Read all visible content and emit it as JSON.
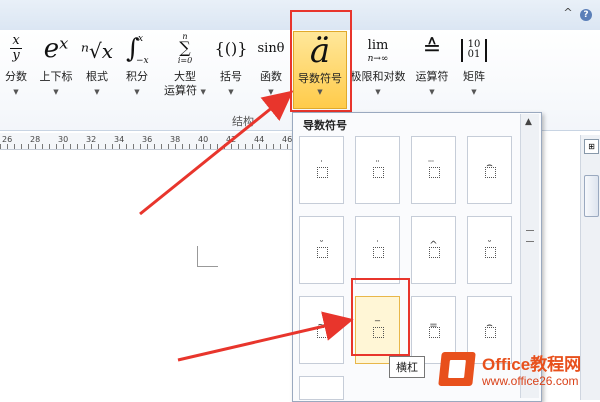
{
  "ribbon": {
    "buttons": [
      {
        "id": "fraction",
        "symbol_top": "x",
        "symbol_bottom": "y",
        "label": "分数"
      },
      {
        "id": "script",
        "symbol": "eˣ",
        "label": "上下标"
      },
      {
        "id": "radical",
        "symbol": "ⁿ√x",
        "label": "根式"
      },
      {
        "id": "integral",
        "symbol": "∫",
        "symbol_sup": "x",
        "symbol_sub": "−x",
        "label": "积分"
      },
      {
        "id": "large-operator",
        "symbol": "∑",
        "symbol_sup": "n",
        "symbol_sub": "i=0",
        "label": "大型运算符",
        "label_line1": "大型",
        "label_line2": "运算符"
      },
      {
        "id": "bracket",
        "symbol": "{()}",
        "label": "括号"
      },
      {
        "id": "function",
        "symbol": "sinθ",
        "label": "函数"
      },
      {
        "id": "accent",
        "symbol": "ä",
        "label": "导数符号"
      },
      {
        "id": "limit-log",
        "symbol": "lim",
        "symbol_sub": "n→∞",
        "label": "极限和对数"
      },
      {
        "id": "operator",
        "symbol": "≙",
        "label": "运算符"
      },
      {
        "id": "matrix",
        "symbol": "10\n01",
        "label": "矩阵"
      }
    ],
    "group_label": "结构"
  },
  "ruler": {
    "ticks": [
      "26",
      "28",
      "30",
      "32",
      "34",
      "36",
      "38",
      "40",
      "42",
      "44",
      "46"
    ]
  },
  "gallery": {
    "title": "导数符号",
    "tiles": [
      {
        "accent": "˙"
      },
      {
        "accent": "¨"
      },
      {
        "accent": "⃛"
      },
      {
        "accent": "⌢"
      },
      {
        "accent": "˘"
      },
      {
        "accent": "˙"
      },
      {
        "accent": "^"
      },
      {
        "accent": "˘"
      },
      {
        "accent": "~"
      },
      {
        "accent": "‾"
      },
      {
        "accent": "="
      },
      {
        "accent": "⌢"
      },
      {
        "accent": ""
      }
    ],
    "selected_index": 9
  },
  "tooltip": {
    "text": "横杠"
  },
  "watermark": {
    "main": "Office教程网",
    "url": "www.office26.com"
  },
  "titlebar": {
    "help_icon": "?",
    "collapse_icon": "^"
  }
}
